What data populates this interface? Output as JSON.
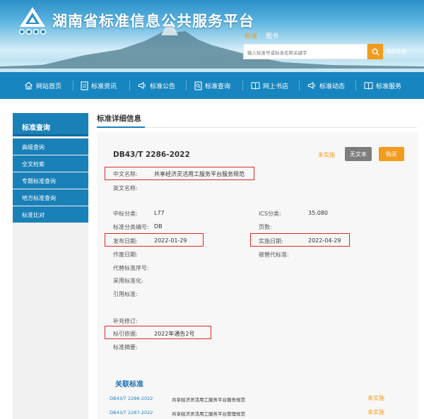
{
  "header": {
    "title": "湖南省标准信息公共服务平台",
    "search_tabs": [
      "标准",
      "图书"
    ],
    "search_placeholder": "输入标准号或标准名称关键字",
    "advanced_search": "高级检索",
    "accent": "#f29b1d",
    "brand": "#1785bf"
  },
  "nav": {
    "items": [
      {
        "label": "网站首页",
        "icon": "home-icon"
      },
      {
        "label": "标准资讯",
        "icon": "document-icon"
      },
      {
        "label": "标准公告",
        "icon": "megaphone-icon"
      },
      {
        "label": "标准查询",
        "icon": "file-search-icon"
      },
      {
        "label": "网上书店",
        "icon": "book-icon"
      },
      {
        "label": "标准动态",
        "icon": "megaphone-icon"
      },
      {
        "label": "标准服务",
        "icon": "book-icon"
      }
    ]
  },
  "sidebar": {
    "title": "标准查询",
    "items": [
      "高级查询",
      "全文检索",
      "专题标准查询",
      "地方标准查询",
      "标准比对"
    ]
  },
  "main": {
    "section_title": "标准详细信息",
    "standard_code": "DB43/T 2286-2022",
    "status": "未实施",
    "no_text_button": "无文本",
    "buy_button": "购买",
    "fields": {
      "cn_name_label": "中文名称:",
      "cn_name_value": "共享经济灵活用工服务平台服务规范",
      "en_name_label": "英文名称:",
      "ccs_label": "中标分类:",
      "ccs_value": "L77",
      "ics_label": "ICS分类:",
      "ics_value": "35.080",
      "class_code_label": "标准分类编号:",
      "class_code_value": "DB",
      "pages_label": "页数:",
      "publish_label": "发布日期:",
      "publish_value": "2022-01-29",
      "implement_label": "实施日期:",
      "implement_value": "2022-04-29",
      "replaced_label": "被替代标准:",
      "void_label": "作废日期:",
      "replace_label": "代替标准序号:",
      "adopt_label": "采用标准化:",
      "cite_label": "引用标准:",
      "supplement_label": "补充修订:",
      "basis_label": "标引依据:",
      "basis_value": "2022年通告2号",
      "abstract_label": "标准摘要:"
    }
  },
  "related": {
    "title": "关联标准",
    "items": [
      {
        "code": "DB43/T 2286-2022",
        "name": "共享经济灵活用工服务平台服务规范",
        "status": "未实施"
      },
      {
        "code": "DB43/T 2287-2022",
        "name": "共享经济灵活用工服务平台管理规范",
        "status": "未实施"
      }
    ]
  }
}
